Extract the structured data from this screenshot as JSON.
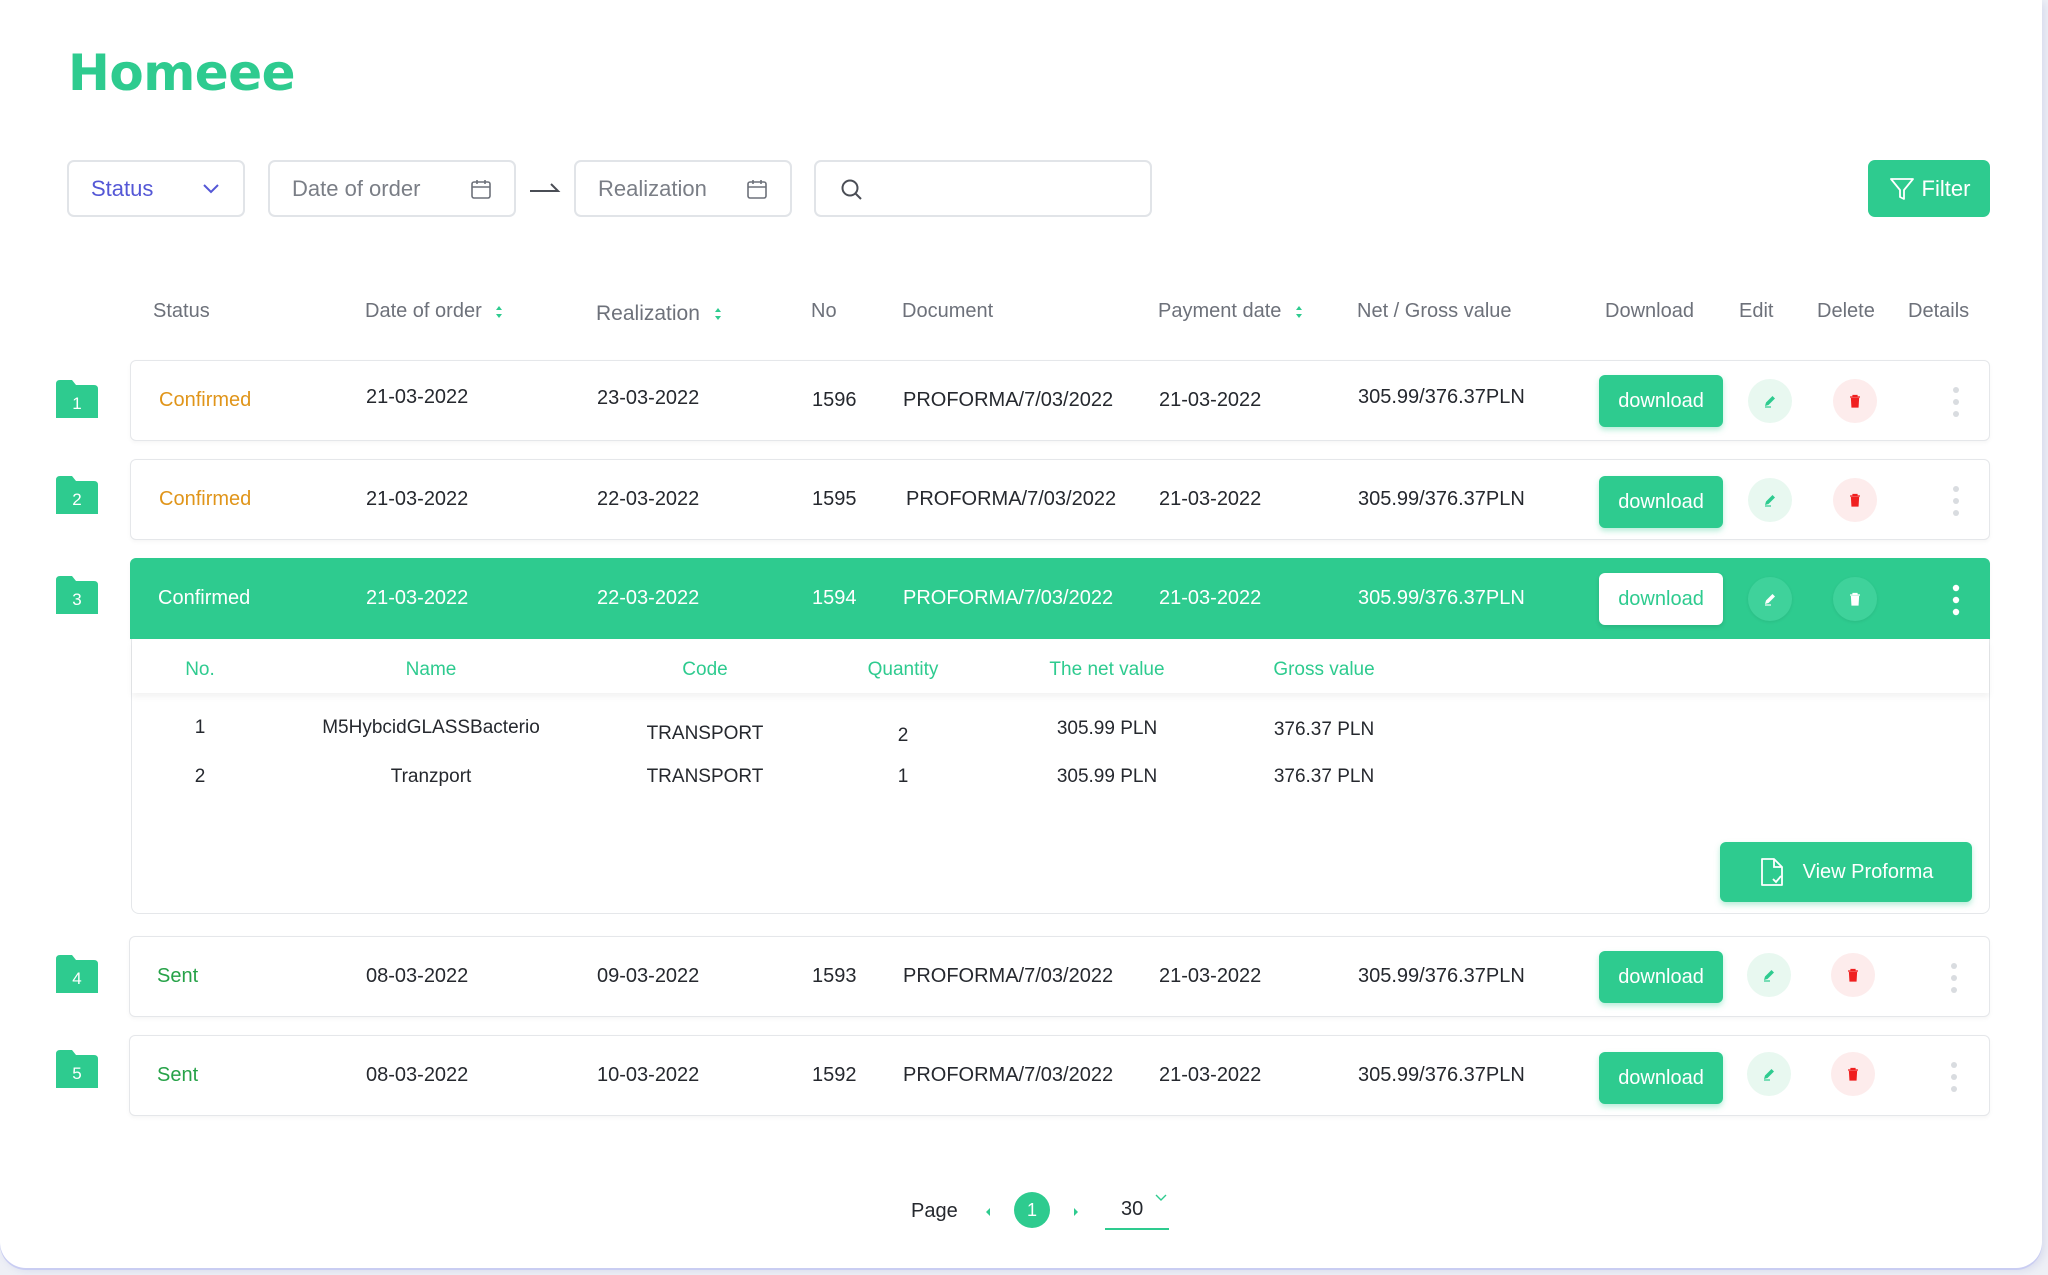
{
  "app": {
    "title": "Homeee"
  },
  "toolbar": {
    "status_label": "Status",
    "date_of_order_placeholder": "Date of order",
    "realization_placeholder": "Realization",
    "search_placeholder": "",
    "filter_label": "Filter"
  },
  "columns": {
    "status": "Status",
    "date_of_order": "Date of order",
    "realization": "Realization",
    "no": "No",
    "document": "Document",
    "payment_date": "Payment date",
    "net_gross": "Net / Gross value",
    "download": "Download",
    "edit": "Edit",
    "delete": "Delete",
    "details": "Details"
  },
  "rows": [
    {
      "index": "1",
      "status": "Confirmed",
      "date_of_order": "21-03-2022",
      "realization": "23-03-2022",
      "no": "1596",
      "document": "PROFORMA/7/03/2022",
      "payment_date": "21-03-2022",
      "value": "305.99/376.37PLN",
      "download": "download"
    },
    {
      "index": "2",
      "status": "Confirmed",
      "date_of_order": "21-03-2022",
      "realization": "22-03-2022",
      "no": "1595",
      "document": "PROFORMA/7/03/2022",
      "payment_date": "21-03-2022",
      "value": "305.99/376.37PLN",
      "download": "download"
    },
    {
      "index": "3",
      "status": "Confirmed",
      "date_of_order": "21-03-2022",
      "realization": "22-03-2022",
      "no": "1594",
      "document": "PROFORMA/7/03/2022",
      "payment_date": "21-03-2022",
      "value": "305.99/376.37PLN",
      "download": "download"
    },
    {
      "index": "4",
      "status": "Sent",
      "date_of_order": "08-03-2022",
      "realization": "09-03-2022",
      "no": "1593",
      "document": "PROFORMA/7/03/2022",
      "payment_date": "21-03-2022",
      "value": "305.99/376.37PLN",
      "download": "download"
    },
    {
      "index": "5",
      "status": "Sent",
      "date_of_order": "08-03-2022",
      "realization": "10-03-2022",
      "no": "1592",
      "document": "PROFORMA/7/03/2022",
      "payment_date": "21-03-2022",
      "value": "305.99/376.37PLN",
      "download": "download"
    }
  ],
  "details": {
    "columns": {
      "no": "No.",
      "name": "Name",
      "code": "Code",
      "quantity": "Quantity",
      "net": "The net value",
      "gross": "Gross value"
    },
    "items": [
      {
        "no": "1",
        "name": "M5HybcidGLASSBacterio",
        "code": "TRANSPORT",
        "quantity": "2",
        "net": "305.99 PLN",
        "gross": "376.37 PLN"
      },
      {
        "no": "2",
        "name": "Tranzport",
        "code": "TRANSPORT",
        "quantity": "1",
        "net": "305.99 PLN",
        "gross": "376.37 PLN"
      }
    ],
    "view_button": "View Proforma"
  },
  "pagination": {
    "label": "Page",
    "current": "1",
    "page_size": "30"
  },
  "colors": {
    "accent": "#2ecb8f",
    "confirmed": "#e0951a",
    "sent": "#26a248",
    "delete": "#f02020",
    "status_select": "#5457d6"
  },
  "icons": [
    "calendar-icon",
    "search-icon",
    "filter-icon",
    "folder-icon",
    "edit-icon",
    "trash-icon",
    "more-dots-icon",
    "document-check-icon",
    "chevron-down-icon"
  ]
}
